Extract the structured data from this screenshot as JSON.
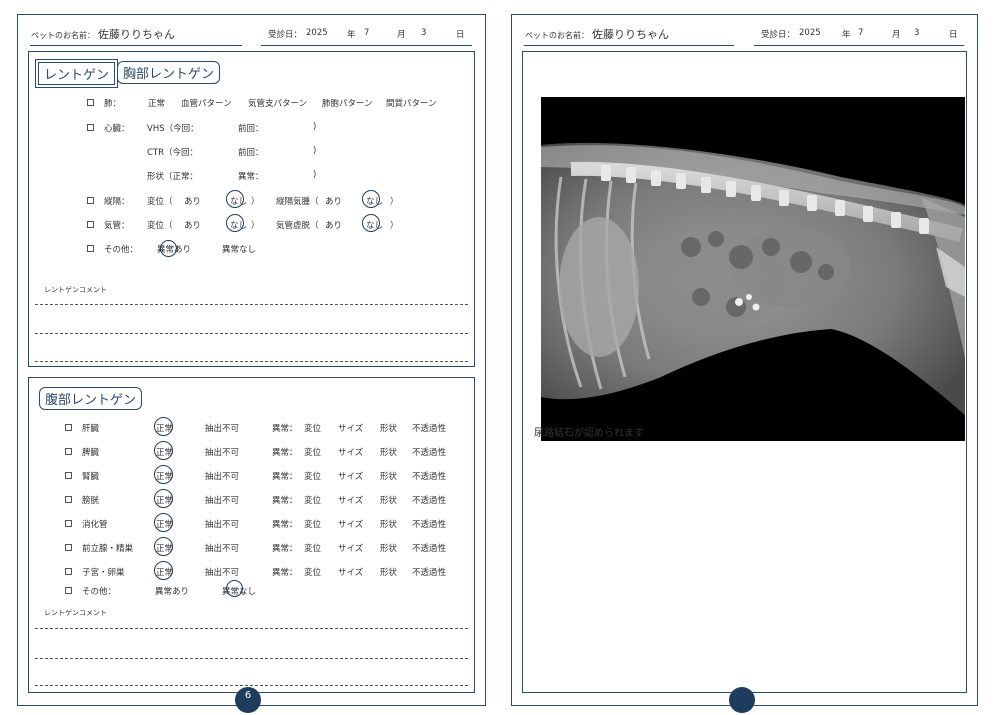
{
  "header": {
    "pet_name_label": "ペットのお名前：",
    "pet_name": "佐藤りりちゃん",
    "visit_label": "受診日：",
    "year": "2025",
    "year_unit": "年",
    "month": "7",
    "month_unit": "月",
    "day": "3",
    "day_unit": "日"
  },
  "chest": {
    "tab_xray": "レントゲン",
    "tab_chest": "胸部レントゲン",
    "lung": {
      "label": "肺：",
      "options": [
        "正常",
        "血管パターン",
        "気管支パターン",
        "肺胞パターン",
        "間質パターン"
      ]
    },
    "heart": {
      "label": "心臓：",
      "vhs": "VHS（今回：",
      "vhs_prev": "前回：",
      "ctr": "CTR（今回：",
      "ctr_prev": "前回：",
      "shape": "形状（正常：",
      "shape_abn": "異常：",
      "close": ")"
    },
    "mediastinum": {
      "label": "縦隔：",
      "shift": "変位（",
      "yes": "あり",
      "no": "なし",
      "close": "）",
      "emph": "縦隔気腫（",
      "yes2": "あり",
      "no2": "なし",
      "close2": "）"
    },
    "trachea": {
      "label": "気管：",
      "shift": "変位（",
      "yes": "あり",
      "no": "なし",
      "close": "）",
      "collapse": "気管虚脱（",
      "yes2": "あり",
      "no2": "なし",
      "close2": "）"
    },
    "other": {
      "label": "その他：",
      "abn": "異常あり",
      "normal": "異常なし"
    },
    "comment_label": "レントゲンコメント"
  },
  "abdomen": {
    "title": "腹部レントゲン",
    "col_normal": "正常",
    "col_unable": "抽出不可",
    "col_abn": "異常：",
    "col_shift": "変位",
    "col_size": "サイズ",
    "col_shape": "形状",
    "col_opacity": "不透過性",
    "rows": [
      {
        "label": "肝臓"
      },
      {
        "label": "脾臓"
      },
      {
        "label": "腎臓"
      },
      {
        "label": "膀胱"
      },
      {
        "label": "消化管"
      },
      {
        "label": "前立腺・精巣"
      },
      {
        "label": "子宮・卵巣"
      }
    ],
    "other": {
      "label": "その他：",
      "abn": "異常あり",
      "normal": "異常なし"
    },
    "comment_label": "レントゲンコメント"
  },
  "page_number": "6",
  "right_comment": "尿路結石が認められます"
}
